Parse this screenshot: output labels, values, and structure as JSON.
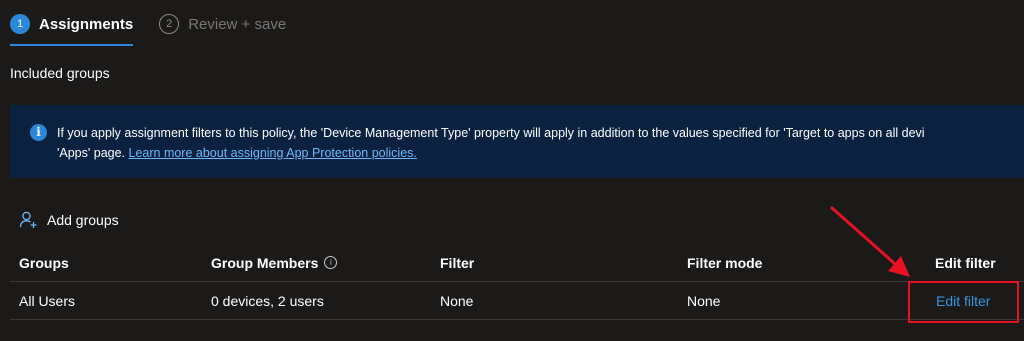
{
  "wizard": {
    "steps": [
      {
        "number": "1",
        "label": "Assignments",
        "active": true
      },
      {
        "number": "2",
        "label": "Review + save",
        "active": false
      }
    ]
  },
  "section": {
    "title": "Included groups"
  },
  "banner": {
    "line1": "If you apply assignment filters to this policy, the 'Device Management Type' property will apply in addition to the values specified for 'Target to apps on all devi",
    "line2_prefix": "'Apps' page. ",
    "link_text": "Learn more about assigning App Protection policies.",
    "icon": "info-icon"
  },
  "actions": {
    "add_groups_label": "Add groups",
    "add_groups_icon": "add-person-icon"
  },
  "table": {
    "headers": {
      "groups": "Groups",
      "members": "Group Members",
      "filter": "Filter",
      "mode": "Filter mode",
      "edit": "Edit filter"
    },
    "rows": [
      {
        "groups": "All Users",
        "members": "0 devices, 2 users",
        "filter": "None",
        "mode": "None",
        "edit": "Edit filter"
      }
    ]
  },
  "colors": {
    "accent": "#2b88d8",
    "link": "#3a96dd",
    "annotation": "#e81123",
    "banner_bg": "#0a2240"
  }
}
